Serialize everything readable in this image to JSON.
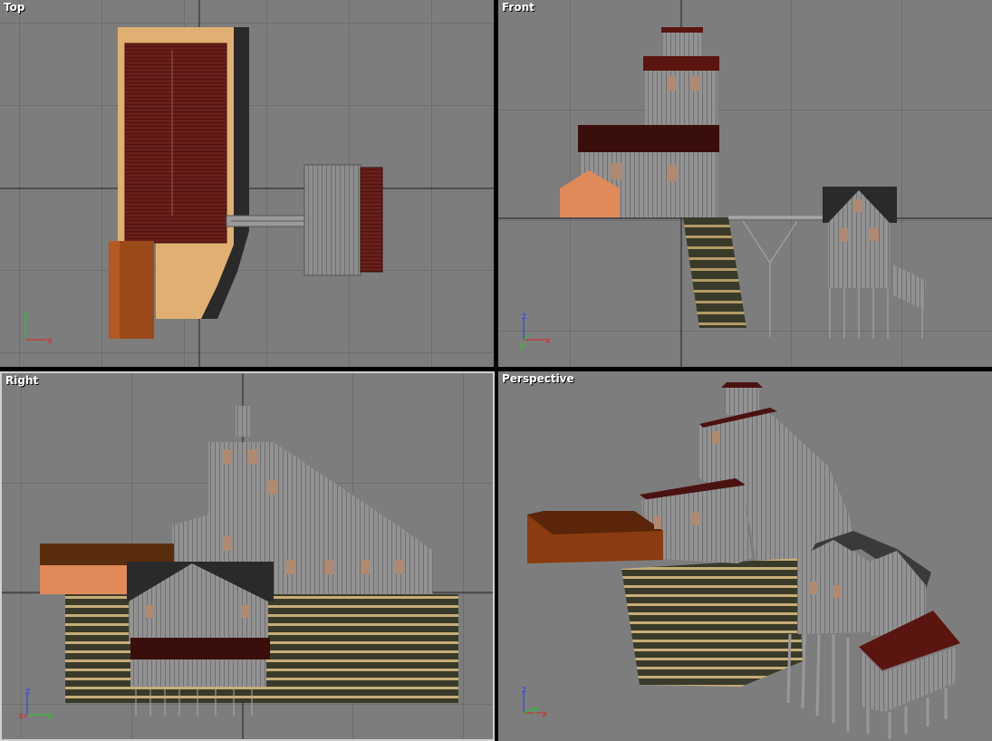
{
  "viewports": {
    "top": {
      "label": "Top",
      "axis_up": "y",
      "axis_right": "x"
    },
    "front": {
      "label": "Front",
      "axis_up": "z",
      "axis_right": "x",
      "axis_depth": "y"
    },
    "right": {
      "label": "Right",
      "axis_up": "z",
      "axis_right": "y",
      "axis_depth": "x"
    },
    "perspective": {
      "label": "Perspective",
      "axis_up": "z",
      "axis_right": "x",
      "axis_depth": "y"
    }
  },
  "colors": {
    "viewport_bg": "#7d7d7d",
    "grid": "#5f5f5f",
    "grid_main": "#1e1e1e",
    "active_border": "#d0d0d0",
    "axis_x": "#e02020",
    "axis_y": "#20d020",
    "axis_z": "#2040ff"
  }
}
